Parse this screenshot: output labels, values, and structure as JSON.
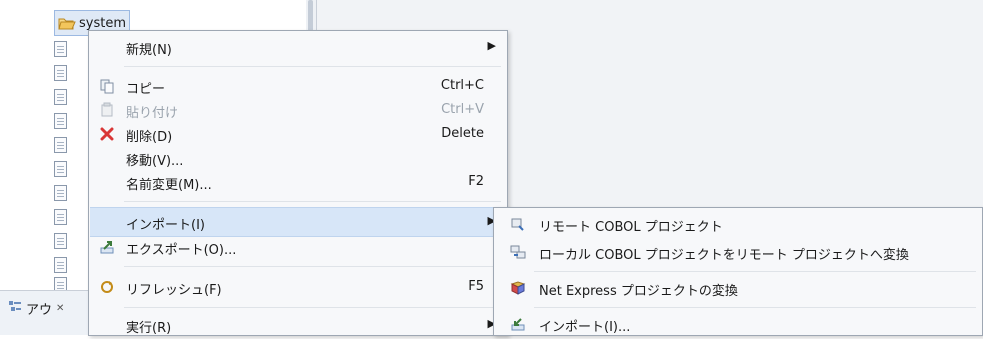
{
  "tree": {
    "folder_label": "system",
    "file_count": 11
  },
  "bottom_tab": {
    "label": "アウ",
    "icon": "outline-icon",
    "close": "close-icon"
  },
  "context_menu": {
    "new": {
      "label": "新規(N)"
    },
    "copy": {
      "label": "コピー",
      "shortcut": "Ctrl+C",
      "icon": "copy-icon"
    },
    "paste": {
      "label": "貼り付け",
      "shortcut": "Ctrl+V",
      "icon": "paste-icon",
      "disabled": true
    },
    "delete": {
      "label": "削除(D)",
      "shortcut": "Delete",
      "icon": "delete-icon",
      "color": "#d93636"
    },
    "move": {
      "label": "移動(V)..."
    },
    "rename": {
      "label": "名前変更(M)...",
      "shortcut": "F2"
    },
    "import": {
      "label": "インポート(I)"
    },
    "export": {
      "label": "エクスポート(O)...",
      "icon": "export-icon"
    },
    "refresh": {
      "label": "リフレッシュ(F)",
      "shortcut": "F5",
      "icon": "refresh-icon"
    },
    "run": {
      "label": "実行(R)"
    }
  },
  "import_submenu": {
    "remote": {
      "label": "リモート COBOL プロジェクト",
      "icon": "remote-project-icon"
    },
    "convert": {
      "label": "ローカル COBOL プロジェクトをリモート プロジェクトへ変換",
      "icon": "convert-project-icon"
    },
    "netexpress": {
      "label": "Net Express プロジェクトの変換",
      "icon": "netexpress-icon"
    },
    "import": {
      "label": "インポート(I)...",
      "icon": "import-icon"
    }
  },
  "colors": {
    "highlight": "#d7e6f8",
    "folder": "#e8b84d",
    "delete": "#d93636"
  }
}
